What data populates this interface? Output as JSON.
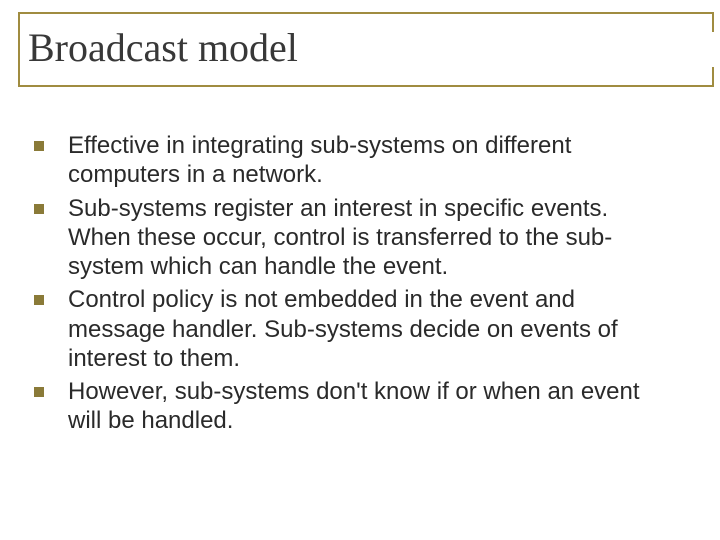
{
  "slide": {
    "title": "Broadcast model",
    "bullets": [
      {
        "text": "Effective in integrating sub-systems on different computers in a network."
      },
      {
        "text": "Sub-systems register an interest in specific events. When these occur, control is transferred to the sub-system which can handle the event."
      },
      {
        "text": "Control policy is not embedded in the event and message handler. Sub-systems decide on events of interest to them."
      },
      {
        "text": "However, sub-systems don't know if or when an event will be handled."
      }
    ]
  }
}
